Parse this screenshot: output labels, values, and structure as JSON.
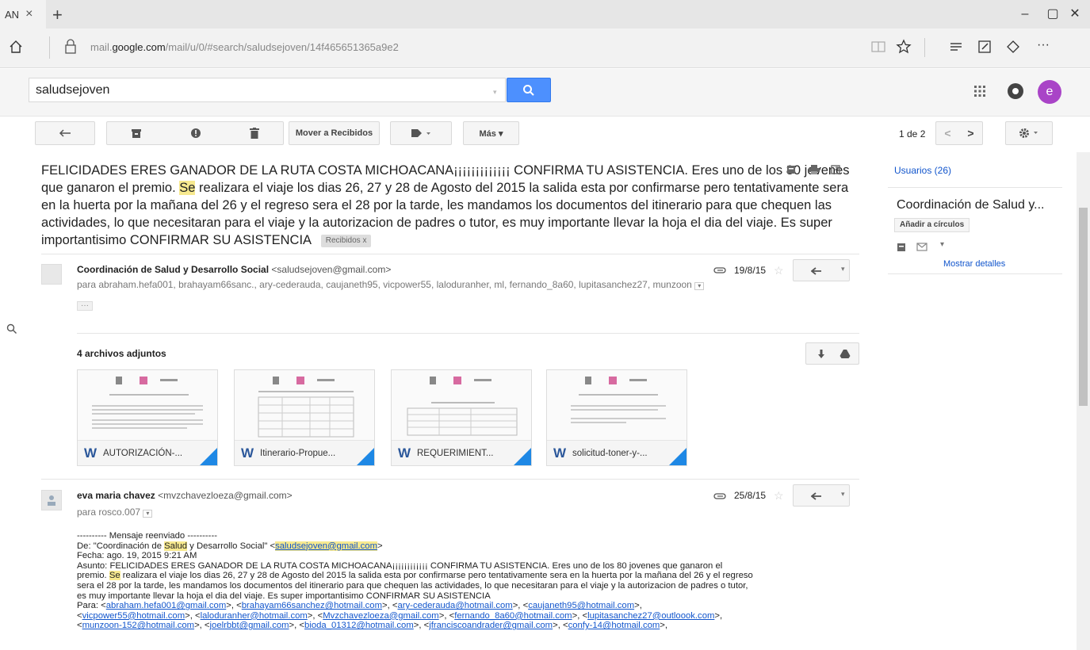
{
  "browser": {
    "tab_title": "AN",
    "tab_close": "×",
    "new_tab": "+",
    "url_prefix": "mail.",
    "url_host": "google.com",
    "url_path": "/mail/u/0/#search/saludsejoven/14f465651365a9e2",
    "minimize": "–",
    "restore": "▢",
    "close": "✕",
    "more": "···"
  },
  "gmail": {
    "search_value": "saludsejoven",
    "user_initial": "e",
    "accent": "#4d90fe",
    "toolbar": {
      "move_label": "Mover a Recibidos",
      "more_label": "Más ▾",
      "pager": "1 de 2"
    }
  },
  "thread": {
    "subject_part1": "FELICIDADES ERES GANADOR DE LA RUTA COSTA MICHOACANA¡¡¡¡¡¡¡¡¡¡¡¡¡ CONFIRMA TU ASISTENCIA. Eres uno de los 80 jovenes que ganaron el premio. ",
    "subject_hl": "Se",
    "subject_part2": " realizara el viaje los dias 26, 27 y 28 de Agosto del 2015 la salida esta por confirmarse pero tentativamente sera en la huerta por la mañana del 26 y el regreso sera el 28 por la tarde, les mandamos los documentos del itinerario para que chequen las actividades, lo que necesitaran para el viaje y la autorizacion de padres o tutor, es muy importante llevar la hoja el dia del viaje. Es super importantisimo CONFIRMAR SU ASISTENCIA",
    "label": "Recibidos  x"
  },
  "message1": {
    "sender_name": "Coordinación de Salud y Desarrollo Social",
    "sender_email": "<saludsejoven@gmail.com>",
    "recipients": "para abraham.hefa001, brahayam66sanc., ary-cederauda, caujaneth95, vicpower55, laloduranher, ml, fernando_8a60, lupitasanchez27, munzoon",
    "date": "19/8/15",
    "ellipsis": "···"
  },
  "attachments": {
    "title": "4 archivos adjuntos",
    "items": [
      {
        "name": "AUTORIZACIÓN-..."
      },
      {
        "name": "Itinerario-Propue..."
      },
      {
        "name": "REQUERIMIENT..."
      },
      {
        "name": "solicitud-toner-y-..."
      }
    ]
  },
  "message2": {
    "sender_name": "eva maria chavez",
    "sender_email": "<mvzchavezloeza@gmail.com>",
    "recipients": "para rosco.007",
    "date": "25/8/15",
    "fwd_header": "---------- Mensaje reenviado ----------",
    "from_prefix": "De: \"Coordinación de ",
    "from_hl": "Salud",
    "from_mid": " y Desarrollo Social\" <",
    "from_link": "saludsejoven@gmail.com",
    "from_suffix": ">",
    "date_line": "Fecha: ago. 19, 2015 9:21 AM",
    "subject_line1": "Asunto: FELICIDADES ERES GANADOR DE LA RUTA COSTA MICHOACANA¡¡¡¡¡¡¡¡¡¡¡¡ CONFIRMA TU ASISTENCIA. Eres uno de los 80 jovenes que ganaron el",
    "subject_line2a": "premio. ",
    "subject_line2_hl": "Se",
    "subject_line2b": " realizara el viaje los dias 26, 27 y 28 de Agosto del 2015 la salida esta por confirmarse pero tentativamente sera en la huerta por la mañana del 26 y el regreso",
    "subject_line3": "sera el 28 por la tarde, les mandamos los documentos del itinerario para que chequen las actividades, lo que necesitaran para el viaje y la autorizacion de padres o tutor,",
    "subject_line4": "es muy importante llevar la hoja el dia del viaje. Es super importantisimo CONFIRMAR SU ASISTENCIA",
    "para_label": "Para: ",
    "to_links": [
      "abraham.hefa001@gmail.com",
      "brahayam66sanchez@hotmail.com",
      "ary-cederauda@hotmail.com",
      "caujaneth95@hotmail.com",
      "vicpower55@hotmail.com",
      "laloduranher@hotmail.com",
      "Mvzchavezloeza@gmail.com",
      "fernando_8a60@hotmail.com",
      "lupitasanchez27@outloook.com",
      "munzoon-152@hotmail.com",
      "joelrbbt@gmail.com",
      "bioda_01312@hotmail.com",
      "jfranciscoandrader@gmail.com",
      "confy-14@hotmail.com"
    ]
  },
  "sidebar": {
    "users": "Usuarios (26)",
    "contact_name": "Coordinación de Salud y...",
    "add_circles": "Añadir a círculos",
    "show_details": "Mostrar detalles"
  }
}
